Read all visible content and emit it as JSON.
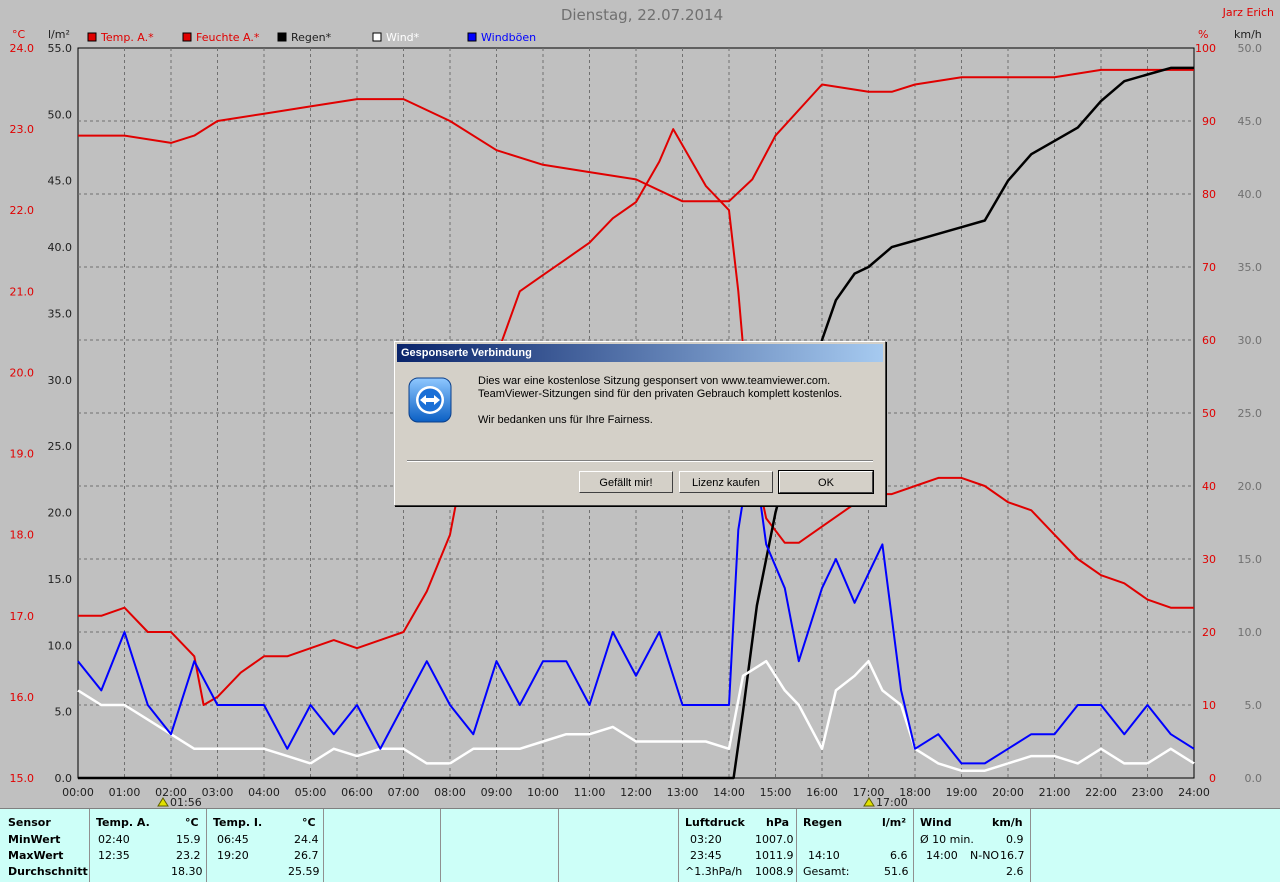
{
  "title": "Dienstag, 22.07.2014",
  "owner": "Jarz Erich",
  "units": {
    "temp": "°C",
    "rain": "l/m²",
    "humidity": "%",
    "wind": "km/h"
  },
  "legend": [
    {
      "label": "Temp. A.*",
      "color": "#e00000"
    },
    {
      "label": "Feuchte A.*",
      "color": "#e00000"
    },
    {
      "label": "Regen*",
      "color": "#000000"
    },
    {
      "label": "Wind*",
      "color": "#ffffff"
    },
    {
      "label": "Windböen",
      "color": "#0000ff"
    }
  ],
  "markers": {
    "min_time": "01:56",
    "max_time": "17:00"
  },
  "chart_data": {
    "type": "line",
    "x_ticks": [
      "00:00",
      "01:00",
      "02:00",
      "03:00",
      "04:00",
      "05:00",
      "06:00",
      "07:00",
      "08:00",
      "09:00",
      "10:00",
      "11:00",
      "12:00",
      "13:00",
      "14:00",
      "15:00",
      "16:00",
      "17:00",
      "18:00",
      "19:00",
      "20:00",
      "21:00",
      "22:00",
      "23:00",
      "24:00"
    ],
    "axes": {
      "temp": {
        "unit": "°C",
        "ylim": [
          15.0,
          24.0
        ],
        "ticks": [
          "15.0",
          "16.0",
          "17.0",
          "18.0",
          "19.0",
          "20.0",
          "21.0",
          "22.0",
          "23.0",
          "24.0"
        ]
      },
      "rain": {
        "unit": "l/m²",
        "ylim": [
          0,
          55
        ],
        "ticks": [
          "0.0",
          "5.0",
          "10.0",
          "15.0",
          "20.0",
          "25.0",
          "30.0",
          "35.0",
          "40.0",
          "45.0",
          "50.0",
          "55.0"
        ]
      },
      "humidity": {
        "unit": "%",
        "ylim": [
          0,
          100
        ],
        "ticks": [
          "0",
          "10",
          "20",
          "30",
          "40",
          "50",
          "60",
          "70",
          "80",
          "90",
          "100"
        ]
      },
      "wind": {
        "unit": "km/h",
        "ylim": [
          0,
          50
        ],
        "ticks": [
          "0.0",
          "5.0",
          "10.0",
          "15.0",
          "20.0",
          "25.0",
          "30.0",
          "35.0",
          "40.0",
          "45.0",
          "50.0"
        ]
      }
    },
    "grid": true,
    "series": [
      {
        "name": "Temp. A.*",
        "axis": "temp",
        "color": "#e00000",
        "points": [
          [
            0,
            17.0
          ],
          [
            0.5,
            17.0
          ],
          [
            1,
            17.1
          ],
          [
            1.5,
            16.8
          ],
          [
            2,
            16.8
          ],
          [
            2.5,
            16.5
          ],
          [
            2.7,
            15.9
          ],
          [
            3,
            16.0
          ],
          [
            3.5,
            16.3
          ],
          [
            4,
            16.5
          ],
          [
            4.5,
            16.5
          ],
          [
            5,
            16.6
          ],
          [
            5.5,
            16.7
          ],
          [
            6,
            16.6
          ],
          [
            6.5,
            16.7
          ],
          [
            7,
            16.8
          ],
          [
            7.5,
            17.3
          ],
          [
            8,
            18.0
          ],
          [
            8.5,
            19.5
          ],
          [
            9,
            20.2
          ],
          [
            9.5,
            21.0
          ],
          [
            10,
            21.2
          ],
          [
            10.5,
            21.4
          ],
          [
            11,
            21.6
          ],
          [
            11.5,
            21.9
          ],
          [
            12,
            22.1
          ],
          [
            12.5,
            22.6
          ],
          [
            12.8,
            23.0
          ],
          [
            13,
            22.8
          ],
          [
            13.5,
            22.3
          ],
          [
            14,
            22.0
          ],
          [
            14.2,
            21.0
          ],
          [
            14.5,
            19.0
          ],
          [
            14.8,
            18.2
          ],
          [
            15.2,
            17.9
          ],
          [
            15.5,
            17.9
          ],
          [
            16,
            18.1
          ],
          [
            16.5,
            18.3
          ],
          [
            17,
            18.5
          ],
          [
            17.5,
            18.5
          ],
          [
            18,
            18.6
          ],
          [
            18.5,
            18.7
          ],
          [
            19,
            18.7
          ],
          [
            19.5,
            18.6
          ],
          [
            20,
            18.4
          ],
          [
            20.5,
            18.3
          ],
          [
            21,
            18.0
          ],
          [
            21.5,
            17.7
          ],
          [
            22,
            17.5
          ],
          [
            22.5,
            17.4
          ],
          [
            23,
            17.2
          ],
          [
            23.5,
            17.1
          ],
          [
            24,
            17.1
          ]
        ]
      },
      {
        "name": "Feuchte A.*",
        "axis": "humidity",
        "color": "#e00000",
        "points": [
          [
            0,
            88
          ],
          [
            1,
            88
          ],
          [
            2,
            87
          ],
          [
            2.5,
            88
          ],
          [
            3,
            90
          ],
          [
            4,
            91
          ],
          [
            5,
            92
          ],
          [
            6,
            93
          ],
          [
            7,
            93
          ],
          [
            8,
            90
          ],
          [
            9,
            86
          ],
          [
            10,
            84
          ],
          [
            11,
            83
          ],
          [
            12,
            82
          ],
          [
            13,
            79
          ],
          [
            14,
            79
          ],
          [
            14.5,
            82
          ],
          [
            15,
            88
          ],
          [
            16,
            95
          ],
          [
            17,
            94
          ],
          [
            17.5,
            94
          ],
          [
            18,
            95
          ],
          [
            19,
            96
          ],
          [
            20,
            96
          ],
          [
            21,
            96
          ],
          [
            22,
            97
          ],
          [
            23,
            97
          ],
          [
            24,
            97
          ]
        ]
      },
      {
        "name": "Regen*",
        "axis": "rain",
        "color": "#000000",
        "points": [
          [
            0,
            0
          ],
          [
            14.1,
            0
          ],
          [
            14.3,
            5
          ],
          [
            14.6,
            13
          ],
          [
            15,
            20
          ],
          [
            15.3,
            24
          ],
          [
            15.7,
            28
          ],
          [
            16,
            33
          ],
          [
            16.3,
            36
          ],
          [
            16.7,
            38
          ],
          [
            17,
            38.5
          ],
          [
            17.5,
            40
          ],
          [
            18,
            40.5
          ],
          [
            18.5,
            41
          ],
          [
            19,
            41.5
          ],
          [
            19.5,
            42
          ],
          [
            20,
            45
          ],
          [
            20.5,
            47
          ],
          [
            21,
            48
          ],
          [
            21.5,
            49
          ],
          [
            22,
            51
          ],
          [
            22.5,
            52.5
          ],
          [
            23,
            53
          ],
          [
            23.5,
            53.5
          ],
          [
            24,
            53.5
          ]
        ]
      },
      {
        "name": "Wind*",
        "axis": "wind",
        "color": "#ffffff",
        "points": [
          [
            0,
            6
          ],
          [
            0.5,
            5
          ],
          [
            1,
            5
          ],
          [
            1.5,
            4
          ],
          [
            2,
            3
          ],
          [
            2.5,
            2
          ],
          [
            3,
            2
          ],
          [
            3.5,
            2
          ],
          [
            4,
            2
          ],
          [
            4.5,
            1.5
          ],
          [
            5,
            1
          ],
          [
            5.5,
            2
          ],
          [
            6,
            1.5
          ],
          [
            6.5,
            2
          ],
          [
            7,
            2
          ],
          [
            7.5,
            1
          ],
          [
            8,
            1
          ],
          [
            8.5,
            2
          ],
          [
            9,
            2
          ],
          [
            9.5,
            2
          ],
          [
            10,
            2.5
          ],
          [
            10.5,
            3
          ],
          [
            11,
            3
          ],
          [
            11.5,
            3.5
          ],
          [
            12,
            2.5
          ],
          [
            12.5,
            2.5
          ],
          [
            13,
            2.5
          ],
          [
            13.5,
            2.5
          ],
          [
            14,
            2
          ],
          [
            14.3,
            7
          ],
          [
            14.8,
            8
          ],
          [
            15.2,
            6
          ],
          [
            15.5,
            5
          ],
          [
            16,
            2
          ],
          [
            16.3,
            6
          ],
          [
            16.7,
            7
          ],
          [
            17,
            8
          ],
          [
            17.3,
            6
          ],
          [
            17.7,
            5
          ],
          [
            18,
            2
          ],
          [
            18.5,
            1
          ],
          [
            19,
            0.5
          ],
          [
            19.5,
            0.5
          ],
          [
            20,
            1
          ],
          [
            20.5,
            1.5
          ],
          [
            21,
            1.5
          ],
          [
            21.5,
            1
          ],
          [
            22,
            2
          ],
          [
            22.5,
            1
          ],
          [
            23,
            1
          ],
          [
            23.5,
            2
          ],
          [
            24,
            1
          ]
        ]
      },
      {
        "name": "Windböen",
        "axis": "wind",
        "color": "#0000ff",
        "points": [
          [
            0,
            8
          ],
          [
            0.5,
            6
          ],
          [
            1,
            10
          ],
          [
            1.5,
            5
          ],
          [
            2,
            3
          ],
          [
            2.5,
            8
          ],
          [
            3,
            5
          ],
          [
            3.5,
            5
          ],
          [
            4,
            5
          ],
          [
            4.5,
            2
          ],
          [
            5,
            5
          ],
          [
            5.5,
            3
          ],
          [
            6,
            5
          ],
          [
            6.5,
            2
          ],
          [
            7,
            5
          ],
          [
            7.5,
            8
          ],
          [
            8,
            5
          ],
          [
            8.5,
            3
          ],
          [
            9,
            8
          ],
          [
            9.5,
            5
          ],
          [
            10,
            8
          ],
          [
            10.5,
            8
          ],
          [
            11,
            5
          ],
          [
            11.5,
            10
          ],
          [
            12,
            7
          ],
          [
            12.5,
            10
          ],
          [
            13,
            5
          ],
          [
            13.5,
            5
          ],
          [
            14,
            5
          ],
          [
            14.2,
            17
          ],
          [
            14.5,
            23
          ],
          [
            14.8,
            16
          ],
          [
            15.2,
            13
          ],
          [
            15.5,
            8
          ],
          [
            16,
            13
          ],
          [
            16.3,
            15
          ],
          [
            16.7,
            12
          ],
          [
            17,
            14
          ],
          [
            17.3,
            16
          ],
          [
            17.7,
            6
          ],
          [
            18,
            2
          ],
          [
            18.5,
            3
          ],
          [
            19,
            1
          ],
          [
            19.5,
            1
          ],
          [
            20,
            2
          ],
          [
            20.5,
            3
          ],
          [
            21,
            3
          ],
          [
            21.5,
            5
          ],
          [
            22,
            5
          ],
          [
            22.5,
            3
          ],
          [
            23,
            5
          ],
          [
            23.5,
            3
          ],
          [
            24,
            2
          ]
        ]
      }
    ]
  },
  "stats": {
    "col1": {
      "header": "Sensor",
      "rows": [
        "MinWert",
        "MaxWert",
        "Durchschnitt"
      ]
    },
    "temp_a": {
      "header": "Temp. A.",
      "unit": "°C",
      "rows": [
        {
          "time": "02:40",
          "val": "15.9"
        },
        {
          "time": "12:35",
          "val": "23.2"
        },
        {
          "time": "",
          "val": "18.30"
        }
      ]
    },
    "temp_i": {
      "header": "Temp. I.",
      "unit": "°C",
      "rows": [
        {
          "time": "06:45",
          "val": "24.4"
        },
        {
          "time": "19:20",
          "val": "26.7"
        },
        {
          "time": "",
          "val": "25.59"
        }
      ]
    },
    "luftdruck": {
      "header": "Luftdruck",
      "unit": "hPa",
      "rows": [
        {
          "time": "03:20",
          "val": "1007.0"
        },
        {
          "time": "23:45",
          "val": "1011.9"
        },
        {
          "time": "^1.3hPa/h",
          "val": "1008.9"
        }
      ]
    },
    "regen": {
      "header": "Regen",
      "unit": "l/m²",
      "rows": [
        {
          "time": "",
          "val": ""
        },
        {
          "time": "14:10",
          "val": "6.6"
        },
        {
          "time": "Gesamt:",
          "val": "51.6"
        }
      ]
    },
    "wind": {
      "header": "Wind",
      "unit": "km/h",
      "rows": [
        {
          "time": "Ø 10 min.",
          "val": "0.9"
        },
        {
          "time": "14:00",
          "dir": "N-NO",
          "val": "16.7"
        },
        {
          "time": "",
          "val": "2.6"
        }
      ]
    }
  },
  "dialog": {
    "title": "Gesponserte Verbindung",
    "line1": "Dies war eine kostenlose Sitzung gesponsert von www.teamviewer.com.",
    "line2": "TeamViewer-Sitzungen sind für den privaten Gebrauch komplett kostenlos.",
    "line3": "Wir bedanken uns für Ihre Fairness.",
    "buttons": {
      "like": "Gefällt mir!",
      "buy": "Lizenz kaufen",
      "ok": "OK"
    }
  }
}
